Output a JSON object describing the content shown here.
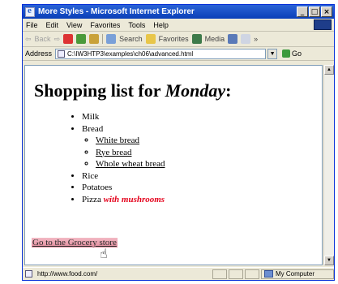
{
  "window": {
    "title": "More Styles - Microsoft Internet Explorer",
    "buttons": {
      "minimize": "_",
      "maximize": "□",
      "close": "×"
    }
  },
  "menu": [
    "File",
    "Edit",
    "View",
    "Favorites",
    "Tools",
    "Help"
  ],
  "toolbar": {
    "back": "Back",
    "search": "Search",
    "favorites": "Favorites",
    "media": "Media",
    "overflow": "»"
  },
  "address": {
    "label": "Address",
    "value": "C:\\IW3HTP3\\examples\\ch06\\advanced.html",
    "go": "Go"
  },
  "page": {
    "heading_prefix": "Shopping list for",
    "heading_day": "Monday",
    "heading_suffix": ":",
    "items": {
      "milk": "Milk",
      "bread": "Bread",
      "bread_types": [
        "White bread",
        "Rye bread",
        "Whole wheat bread"
      ],
      "rice": "Rice",
      "potatoes": "Potatoes",
      "pizza": "Pizza",
      "pizza_extra": "with mushrooms"
    },
    "link": "Go to the Grocery store"
  },
  "status": {
    "url": "http://www.food.com/",
    "zone": "My Computer"
  }
}
